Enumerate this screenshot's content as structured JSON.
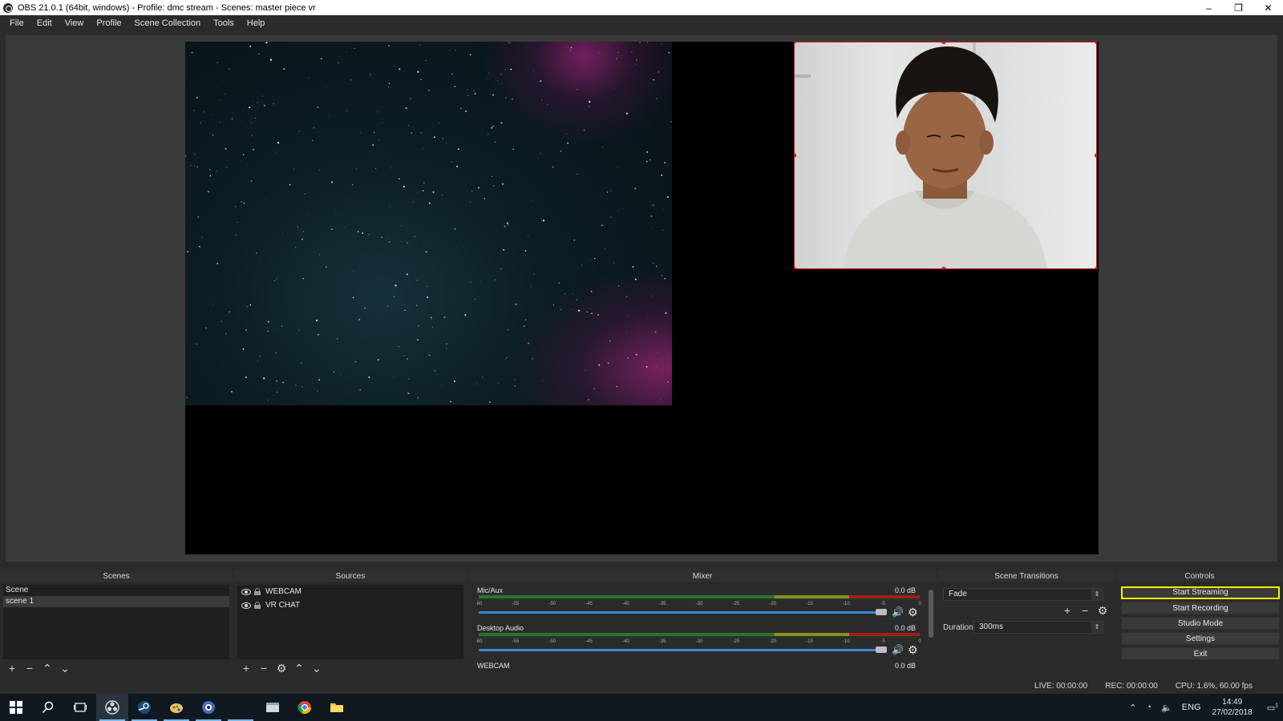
{
  "window": {
    "title": "OBS 21.0.1 (64bit, windows) - Profile: dmc stream - Scenes: master piece vr",
    "minimize": "–",
    "restore": "❐",
    "close": "✕"
  },
  "menu": [
    "File",
    "Edit",
    "View",
    "Profile",
    "Scene Collection",
    "Tools",
    "Help"
  ],
  "docks": {
    "scenes": {
      "title": "Scenes",
      "items": [
        "Scene",
        "scene 1"
      ]
    },
    "sources": {
      "title": "Sources",
      "items": [
        "WEBCAM",
        "VR CHAT"
      ]
    },
    "mixer": {
      "title": "Mixer",
      "scale": [
        "-60",
        "-55",
        "-50",
        "-45",
        "-40",
        "-35",
        "-30",
        "-25",
        "-20",
        "-15",
        "-10",
        "-5",
        "0"
      ],
      "channels": [
        {
          "name": "Mic/Aux",
          "db": "0.0 dB"
        },
        {
          "name": "Desktop Audio",
          "db": "0.0 dB"
        },
        {
          "name": "WEBCAM",
          "db": "0.0 dB"
        }
      ]
    },
    "transitions": {
      "title": "Scene Transitions",
      "selected": "Fade",
      "duration_label": "Duration",
      "duration_value": "300ms"
    },
    "controls": {
      "title": "Controls",
      "start_streaming": "Start Streaming",
      "start_recording": "Start Recording",
      "studio_mode": "Studio Mode",
      "settings": "Settings",
      "exit": "Exit"
    }
  },
  "status": {
    "live": "LIVE: 00:00:00",
    "rec": "REC: 00:00:00",
    "cpu": "CPU: 1.6%, 60.00 fps"
  },
  "taskbar": {
    "lang": "ENG",
    "time": "14:49",
    "date": "27/02/2018",
    "notifications": "1"
  },
  "colors": {
    "selection_border": "#e01818",
    "highlight": "#ffec00",
    "fader": "#3d86d6"
  }
}
